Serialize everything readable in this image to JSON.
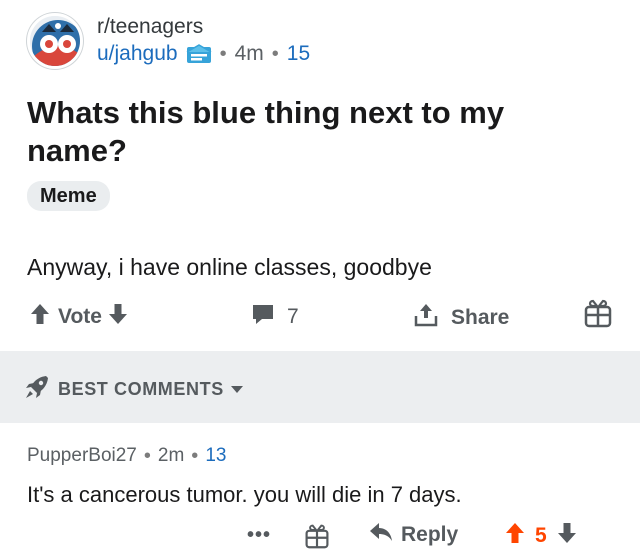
{
  "post": {
    "subreddit": "r/teenagers",
    "username": "u/jahgub",
    "flair_icon": "blue-badge-icon",
    "separator": "•",
    "time": "4m",
    "score": "15",
    "title": "Whats this blue thing next to my name?",
    "flair": "Meme",
    "body": "Anyway, i have online classes, goodbye",
    "actions": {
      "vote_label": "Vote",
      "comments_count": "7",
      "share_label": "Share"
    }
  },
  "sort": {
    "label": "BEST COMMENTS"
  },
  "comment": {
    "author": "PupperBoi27",
    "time": "2m",
    "score": "13",
    "body": "It's a cancerous tumor. you will die in 7 days.",
    "more_label": "•••",
    "reply_label": "Reply",
    "vote_count": "5"
  },
  "colors": {
    "accent_blue": "#1c6cbd",
    "upvote_orange": "#ff4500",
    "icon_gray": "#555a5e",
    "sort_bar_bg": "#eceef0",
    "flair_blue": "#36a3d9"
  }
}
